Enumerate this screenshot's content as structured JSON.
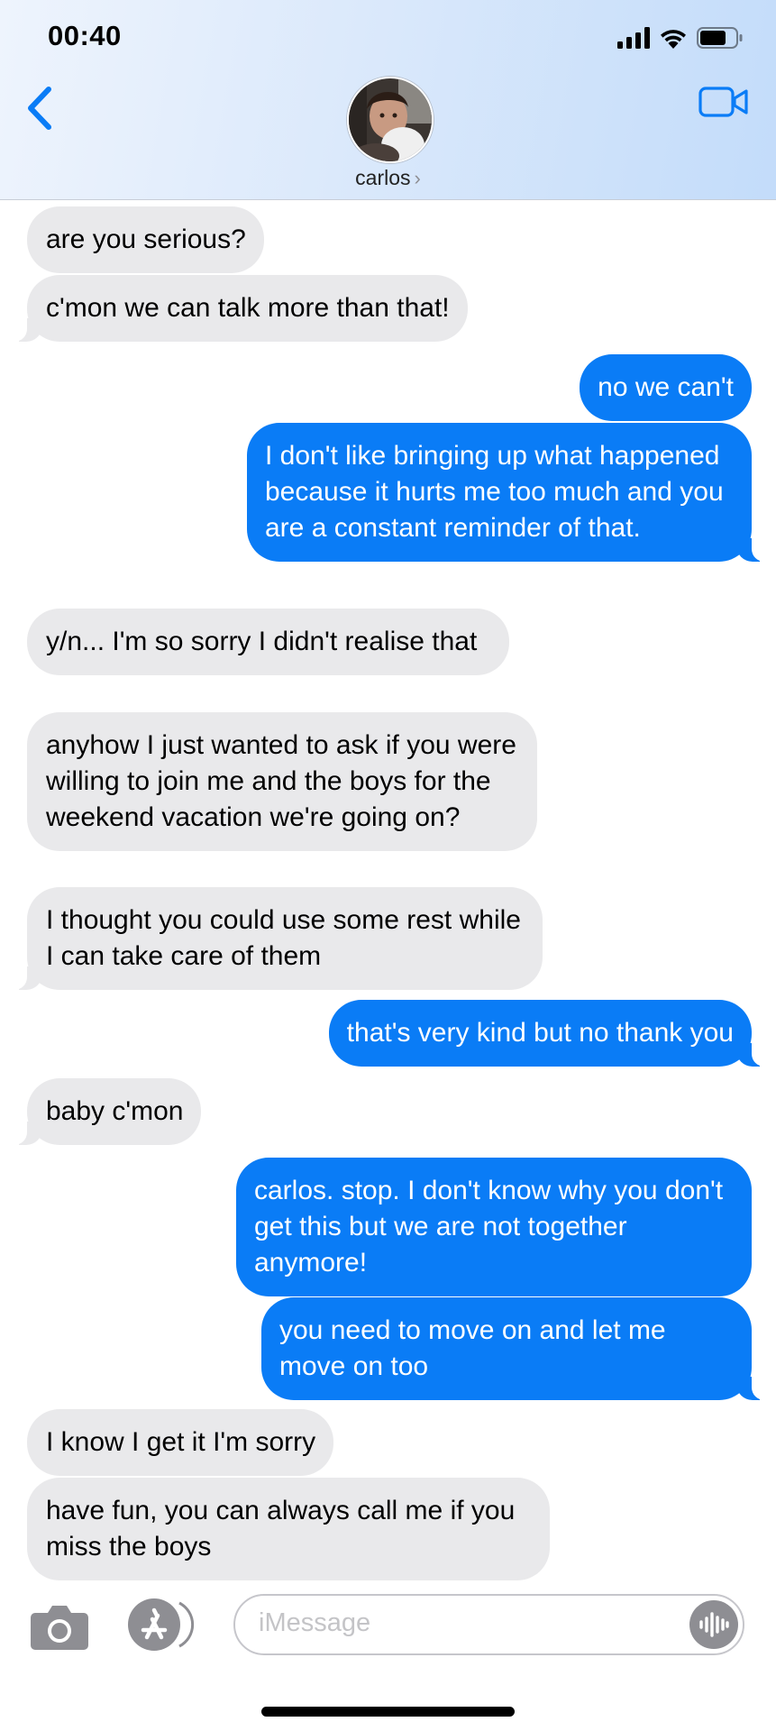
{
  "status_bar": {
    "time": "00:40"
  },
  "header": {
    "contact_name": "carlos",
    "contact_chevron": "›"
  },
  "icons": {
    "back": "chevron-left-icon",
    "video": "video-camera-icon",
    "camera": "camera-icon",
    "apps": "app-store-icon",
    "audio": "audio-waveform-icon",
    "signal": "cellular-signal-icon",
    "wifi": "wifi-icon",
    "battery": "battery-icon"
  },
  "colors": {
    "outgoing": "#0a7cf6",
    "incoming": "#e9e9eb",
    "accent": "#0a7cf6"
  },
  "messages": [
    {
      "sender": "carlos",
      "text": "are you serious?"
    },
    {
      "sender": "carlos",
      "text": "c'mon we can talk more than that!"
    },
    {
      "sender": "me",
      "text": "no we can't"
    },
    {
      "sender": "me",
      "text": "I don't like bringing up what happened because it hurts me too much and you are a constant reminder of that."
    },
    {
      "sender": "carlos",
      "text": "y/n... I'm so sorry I didn't realise that"
    },
    {
      "sender": "carlos",
      "text": "anyhow I just wanted to ask if you were willing to join me and the boys for the weekend vacation we're going on?"
    },
    {
      "sender": "carlos",
      "text": "I thought you could use some rest while I can take care of them"
    },
    {
      "sender": "me",
      "text": "that's very kind but no thank you"
    },
    {
      "sender": "carlos",
      "text": "baby c'mon"
    },
    {
      "sender": "me",
      "text": "carlos. stop. I don't know why you don't get this but we are not together anymore!"
    },
    {
      "sender": "me",
      "text": "you need to move on and let me move on too"
    },
    {
      "sender": "carlos",
      "text": "I know I get it I'm sorry"
    },
    {
      "sender": "carlos",
      "text": "have fun, you can always call me if you miss the boys"
    }
  ],
  "compose": {
    "placeholder": "iMessage"
  }
}
